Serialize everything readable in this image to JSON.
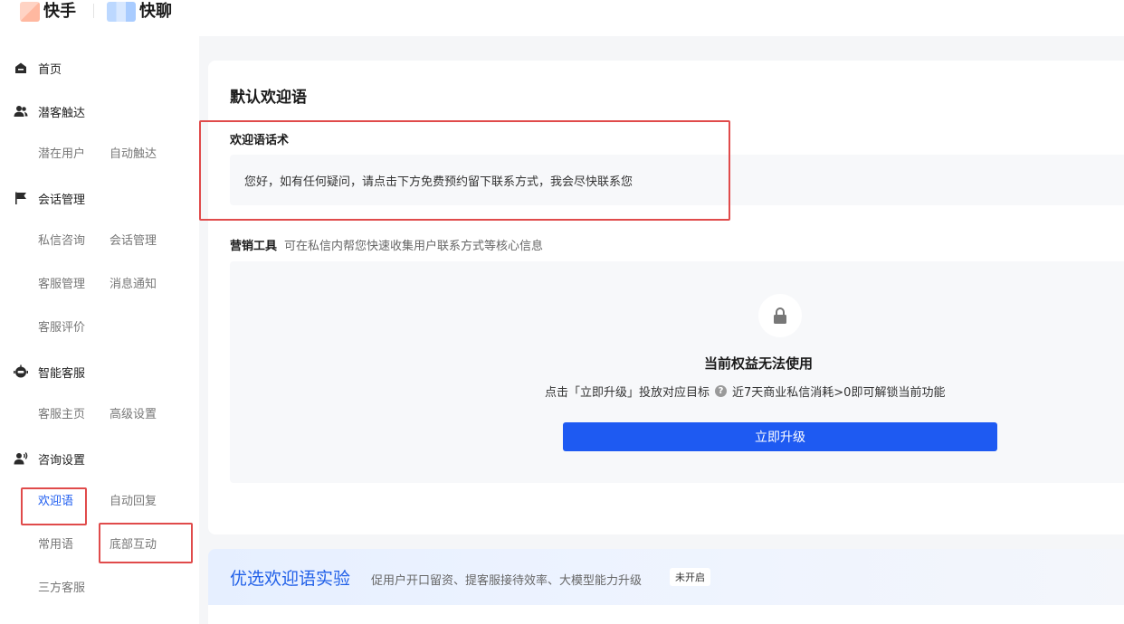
{
  "header": {
    "brand_kuaishou": "快手",
    "brand_kuailiao": "快聊"
  },
  "sidebar": {
    "groups": [
      {
        "label": "首页",
        "icon": "home-icon"
      },
      {
        "label": "潜客触达",
        "icon": "users-icon",
        "items": [
          "潜在用户",
          "自动触达"
        ]
      },
      {
        "label": "会话管理",
        "icon": "chat-flag-icon",
        "items": [
          "私信咨询",
          "会话管理",
          "客服管理",
          "消息通知",
          "客服评价"
        ]
      },
      {
        "label": "智能客服",
        "icon": "robot-icon",
        "items": [
          "客服主页",
          "高级设置"
        ]
      },
      {
        "label": "咨询设置",
        "icon": "user-voice-icon",
        "items": [
          "欢迎语",
          "自动回复",
          "常用语",
          "底部互动",
          "三方客服"
        ]
      }
    ],
    "active_item": "欢迎语"
  },
  "main": {
    "title": "默认欢迎语",
    "greeting_label": "欢迎语话术",
    "greeting_text": "您好，如有任何疑问，请点击下方免费预约留下联系方式，我会尽快联系您",
    "tools_label": "营销工具",
    "tools_desc": "可在私信内帮您快速收集用户联系方式等核心信息",
    "locked_title": "当前权益无法使用",
    "locked_desc_prefix": "点击「立即升级」投放对应目标",
    "locked_desc_suffix": "近7天商业私信消耗>0即可解锁当前功能",
    "upgrade_button": "立即升级"
  },
  "banner": {
    "title": "优选欢迎语实验",
    "desc": "促用户开口留资、提客服接待效率、大模型能力升级",
    "badge": "未开启"
  },
  "colors": {
    "accent": "#1e5af2",
    "active_text": "#1d5cf0",
    "highlight_border": "#e04b4b",
    "banner_title": "#2160e8"
  }
}
